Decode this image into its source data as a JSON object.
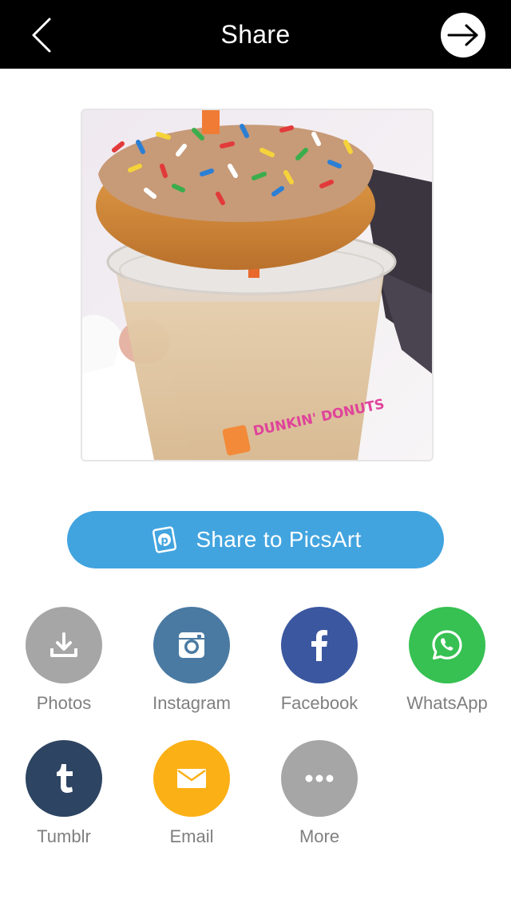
{
  "header": {
    "title": "Share",
    "back_icon": "chevron-left-icon",
    "next_icon": "arrow-right-icon"
  },
  "preview": {
    "image_text": "DUNKIN' DONUTS"
  },
  "picsart_button": {
    "label": "Share to PicsArt",
    "icon": "picsart-logo-icon",
    "color": "#42a4df"
  },
  "share_targets": [
    {
      "label": "Photos",
      "icon": "download-icon",
      "color": "#a6a6a6"
    },
    {
      "label": "Instagram",
      "icon": "instagram-icon",
      "color": "#4a7aa2"
    },
    {
      "label": "Facebook",
      "icon": "facebook-icon",
      "color": "#3b57a0"
    },
    {
      "label": "WhatsApp",
      "icon": "whatsapp-icon",
      "color": "#36c152"
    },
    {
      "label": "Tumblr",
      "icon": "tumblr-icon",
      "color": "#2d4462"
    },
    {
      "label": "Email",
      "icon": "email-icon",
      "color": "#fbb016"
    },
    {
      "label": "More",
      "icon": "more-icon",
      "color": "#a6a6a6"
    }
  ]
}
